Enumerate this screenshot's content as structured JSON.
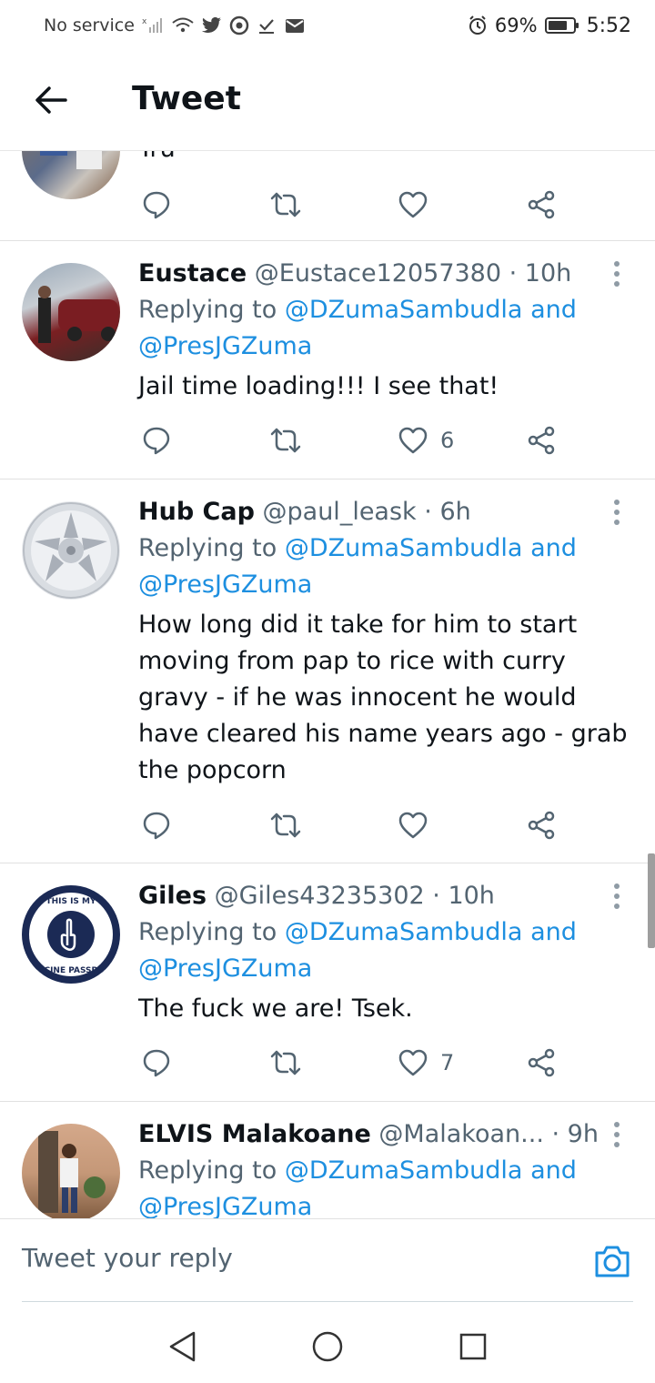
{
  "status_bar": {
    "carrier": "No service",
    "battery_pct": "69%",
    "time": "5:52",
    "icons": [
      "signal-off-icon",
      "wifi-icon",
      "twitter-bird-icon",
      "chrome-icon",
      "download-done-icon",
      "mail-icon",
      "alarm-icon",
      "battery-icon"
    ]
  },
  "header": {
    "title": "Tweet",
    "back_icon": "arrow-left-icon"
  },
  "tweets": [
    {
      "name": "",
      "handle": "",
      "time": "",
      "replying_prefix": "",
      "replying_to_1": "",
      "replying_to_and": "",
      "replying_to_2": "",
      "text": "Tru",
      "likes": ""
    },
    {
      "name": "Eustace",
      "handle": "@Eustace12057380",
      "time": "· 10h",
      "replying_prefix": "Replying to ",
      "replying_to_1": "@DZumaSambudla",
      "replying_to_and": " and",
      "replying_to_2": "@PresJGZuma",
      "text": "Jail time loading!!! I see that!",
      "likes": "6"
    },
    {
      "name": "Hub Cap",
      "handle": "@paul_leask",
      "time": "· 6h",
      "replying_prefix": "Replying to ",
      "replying_to_1": "@DZumaSambudla",
      "replying_to_and": " and",
      "replying_to_2": "@PresJGZuma",
      "text": "How long did it take for him to start moving from pap to rice with curry gravy - if he was innocent he would have cleared his name years ago - grab the popcorn",
      "likes": ""
    },
    {
      "name": "Giles",
      "handle": "@Giles43235302",
      "time": "· 10h",
      "replying_prefix": "Replying to ",
      "replying_to_1": "@DZumaSambudla",
      "replying_to_and": " and",
      "replying_to_2": "@PresJGZuma",
      "text": "The fuck we are! Tsek.",
      "likes": "7",
      "avatar_text_top": "THIS IS MY",
      "avatar_text_bottom": "VACCINE PASSPORT"
    },
    {
      "name": "ELVIS Malakoane",
      "handle": "@Malakoan...",
      "time": "· 9h",
      "replying_prefix": "Replying to ",
      "replying_to_1": "@DZumaSambudla",
      "replying_to_and": " and",
      "replying_to_2": "@PresJGZuma",
      "text": "",
      "likes": ""
    }
  ],
  "compose": {
    "placeholder": "Tweet your reply",
    "camera_icon": "camera-icon"
  },
  "navbar": {
    "icons": [
      "nav-back-icon",
      "nav-home-icon",
      "nav-recents-icon"
    ]
  },
  "colors": {
    "accent": "#1d8fe0",
    "text": "#0f1419",
    "secondary": "#536471",
    "divider": "#e1e1e1"
  }
}
